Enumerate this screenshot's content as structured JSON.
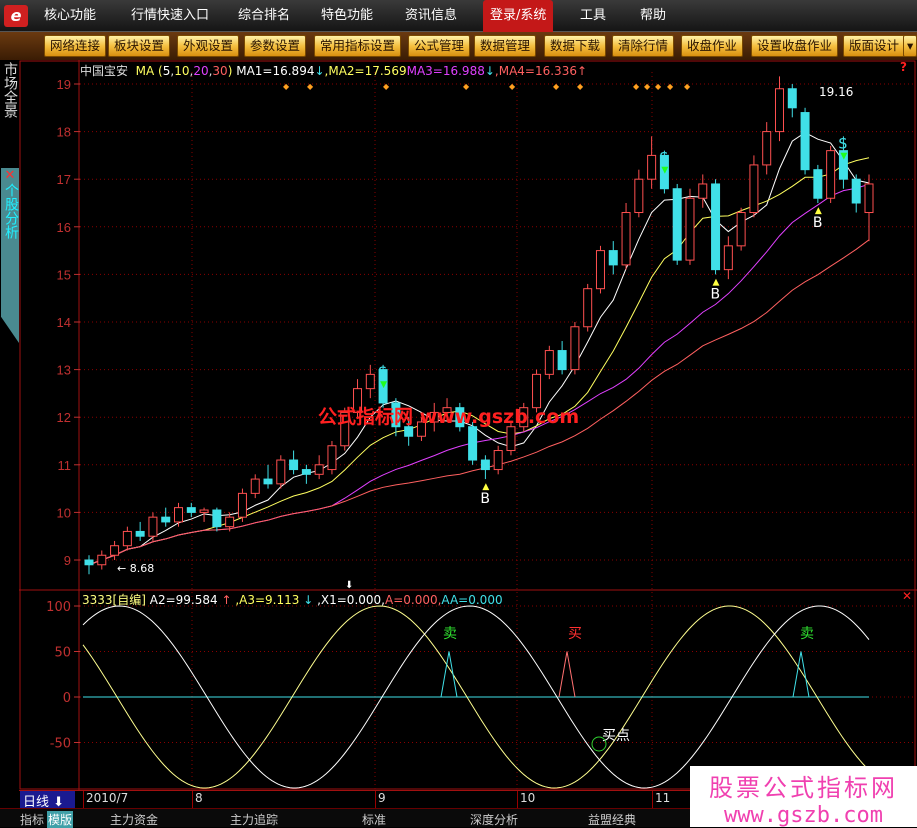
{
  "menu": {
    "items": [
      "核心功能",
      "行情快速入口",
      "综合排名",
      "特色功能",
      "资讯信息",
      "登录/系统",
      "工具",
      "帮助"
    ],
    "active": "登录/系统"
  },
  "toolbar": {
    "buttons": [
      "网络连接",
      "板块设置",
      "外观设置",
      "参数设置",
      "常用指标设置",
      "公式管理",
      "数据管理",
      "数据下载",
      "清除行情",
      "收盘作业",
      "设置收盘作业",
      "版面设计"
    ]
  },
  "sidebar": {
    "market": "市场全景",
    "stock": "个股分析"
  },
  "main": {
    "stock_name": "中国宝安",
    "ma_label": "MA",
    "ma_periods": [
      "5",
      "10",
      "20",
      "30"
    ],
    "ma1": "MA1=16.894",
    "ma2": ",MA2=17.569",
    "ma3": "MA3=16.988",
    "ma4": ",MA4=16.336",
    "high_label": "19.16",
    "low_label": "8.68",
    "price_ticks": [
      9,
      10,
      11,
      12,
      13,
      14,
      15,
      16,
      17,
      18,
      19
    ],
    "watermark_center": "公式指标网 www.gszb.com",
    "signals": {
      "sell": "S",
      "buy": "B"
    }
  },
  "indicator": {
    "name": "3333[自编]",
    "a2": "A2=99.584",
    "a3": ",A3=9.113",
    "x1": ",X1=0.000,",
    "a": "A=0.000,",
    "aa": "AA=0.000",
    "ticks": [
      100,
      50,
      0,
      -50
    ],
    "sell_label": "卖",
    "buy_label": "买",
    "buy_point": "买点"
  },
  "datebar": {
    "period": "日线",
    "months": [
      "2010/7",
      "8",
      "9",
      "10",
      "11"
    ]
  },
  "bottom_tabs": [
    "指标",
    "模版",
    "主力资金",
    "主力追踪",
    "标准",
    "深度分析",
    "益盟经典"
  ],
  "watermark": {
    "line1": "股票公式指标网",
    "line2": "www.gszb.com"
  },
  "colors": {
    "up": "#ff5050",
    "down": "#40e0e8",
    "ma1": "#ffffff",
    "ma2": "#ffff60",
    "ma3": "#e040ff",
    "ma4": "#ff6060",
    "grid": "#8a0000",
    "axis": "#c03030"
  },
  "chart_data": {
    "type": "candlestick",
    "ylim": [
      8.6,
      19.4
    ],
    "candles": [
      [
        9.0,
        9.1,
        8.7,
        8.9
      ],
      [
        8.9,
        9.2,
        8.8,
        9.1
      ],
      [
        9.1,
        9.4,
        9.0,
        9.3
      ],
      [
        9.3,
        9.7,
        9.2,
        9.6
      ],
      [
        9.6,
        9.8,
        9.4,
        9.5
      ],
      [
        9.5,
        10.0,
        9.4,
        9.9
      ],
      [
        9.9,
        10.1,
        9.7,
        9.8
      ],
      [
        9.8,
        10.2,
        9.7,
        10.1
      ],
      [
        10.1,
        10.2,
        9.9,
        10.0
      ],
      [
        10.0,
        10.1,
        9.8,
        10.05
      ],
      [
        10.05,
        10.1,
        9.6,
        9.7
      ],
      [
        9.7,
        10.0,
        9.6,
        9.9
      ],
      [
        9.9,
        10.5,
        9.8,
        10.4
      ],
      [
        10.4,
        10.8,
        10.3,
        10.7
      ],
      [
        10.7,
        11.0,
        10.5,
        10.6
      ],
      [
        10.6,
        11.2,
        10.5,
        11.1
      ],
      [
        11.1,
        11.3,
        10.8,
        10.9
      ],
      [
        10.9,
        11.0,
        10.6,
        10.8
      ],
      [
        10.8,
        11.2,
        10.7,
        11.0
      ],
      [
        10.9,
        11.5,
        10.8,
        11.4
      ],
      [
        11.4,
        12.2,
        11.3,
        12.1
      ],
      [
        12.1,
        12.8,
        12.0,
        12.6
      ],
      [
        12.6,
        13.1,
        12.4,
        12.9
      ],
      [
        13.0,
        13.1,
        12.2,
        12.3
      ],
      [
        12.3,
        12.4,
        11.6,
        11.8
      ],
      [
        11.8,
        12.0,
        11.4,
        11.6
      ],
      [
        11.6,
        12.0,
        11.5,
        11.9
      ],
      [
        11.9,
        12.3,
        11.7,
        12.1
      ],
      [
        12.1,
        12.4,
        11.9,
        12.2
      ],
      [
        12.2,
        12.3,
        11.7,
        11.8
      ],
      [
        11.8,
        11.9,
        11.0,
        11.1
      ],
      [
        11.1,
        11.2,
        10.7,
        10.9
      ],
      [
        10.9,
        11.4,
        10.8,
        11.3
      ],
      [
        11.3,
        11.9,
        11.2,
        11.8
      ],
      [
        11.8,
        12.3,
        11.7,
        12.2
      ],
      [
        12.2,
        13.0,
        12.1,
        12.9
      ],
      [
        12.9,
        13.5,
        12.8,
        13.4
      ],
      [
        13.4,
        13.6,
        12.9,
        13.0
      ],
      [
        13.0,
        14.0,
        12.9,
        13.9
      ],
      [
        13.9,
        14.8,
        13.8,
        14.7
      ],
      [
        14.7,
        15.6,
        14.6,
        15.5
      ],
      [
        15.5,
        15.7,
        15.0,
        15.2
      ],
      [
        15.2,
        16.5,
        15.1,
        16.3
      ],
      [
        16.3,
        17.2,
        16.2,
        17.0
      ],
      [
        17.0,
        17.9,
        16.8,
        17.5
      ],
      [
        17.5,
        17.6,
        16.7,
        16.8
      ],
      [
        16.8,
        16.9,
        15.2,
        15.3
      ],
      [
        15.3,
        16.8,
        15.2,
        16.6
      ],
      [
        16.6,
        17.1,
        16.4,
        16.9
      ],
      [
        16.9,
        17.0,
        15.0,
        15.1
      ],
      [
        15.1,
        15.8,
        14.9,
        15.6
      ],
      [
        15.6,
        16.4,
        15.5,
        16.3
      ],
      [
        16.3,
        17.5,
        16.2,
        17.3
      ],
      [
        17.3,
        18.2,
        17.1,
        18.0
      ],
      [
        18.0,
        19.16,
        17.8,
        18.9
      ],
      [
        18.9,
        19.0,
        18.3,
        18.5
      ],
      [
        18.4,
        18.5,
        17.1,
        17.2
      ],
      [
        17.2,
        17.3,
        16.5,
        16.6
      ],
      [
        16.6,
        17.7,
        16.5,
        17.6
      ],
      [
        17.6,
        17.9,
        16.8,
        17.0
      ],
      [
        17.0,
        17.1,
        16.3,
        16.5
      ],
      [
        16.3,
        17.1,
        15.7,
        16.9
      ]
    ],
    "sell_signals": [
      23,
      45,
      59
    ],
    "buy_signals": [
      31,
      49,
      57
    ],
    "indicator_ylim": [
      -100,
      100
    ]
  }
}
